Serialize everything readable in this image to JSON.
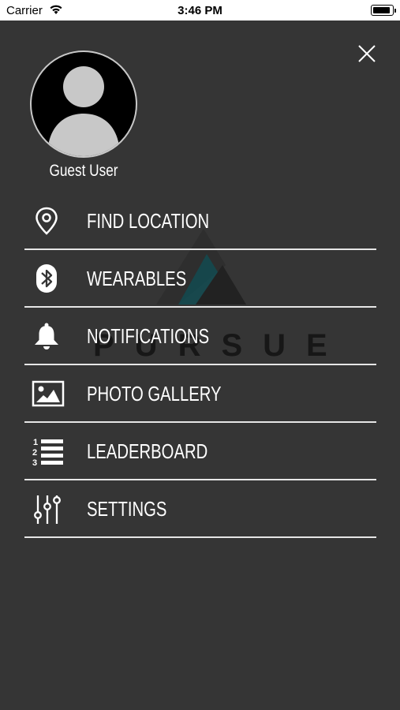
{
  "status_bar": {
    "carrier": "Carrier",
    "time": "3:46 PM",
    "battery_level": 1.0
  },
  "drawer": {
    "close_icon": "close-icon",
    "avatar_icon": "person-icon",
    "user_name": "Guest User",
    "watermark_text": "PURSUE",
    "menu_items": [
      {
        "label": "FIND LOCATION",
        "icon": "location-pin-icon"
      },
      {
        "label": "WEARABLES",
        "icon": "bluetooth-icon"
      },
      {
        "label": "NOTIFICATIONS",
        "icon": "bell-icon"
      },
      {
        "label": "PHOTO GALLERY",
        "icon": "image-icon"
      },
      {
        "label": "LEADERBOARD",
        "icon": "numbered-list-icon"
      },
      {
        "label": "SETTINGS",
        "icon": "sliders-icon"
      }
    ]
  },
  "colors": {
    "background": "#353535",
    "text": "#ffffff",
    "divider": "#e6e6e6",
    "avatar_fill": "#000000",
    "avatar_figure": "#c8c8c8",
    "watermark_accent": "#0f4f55"
  }
}
